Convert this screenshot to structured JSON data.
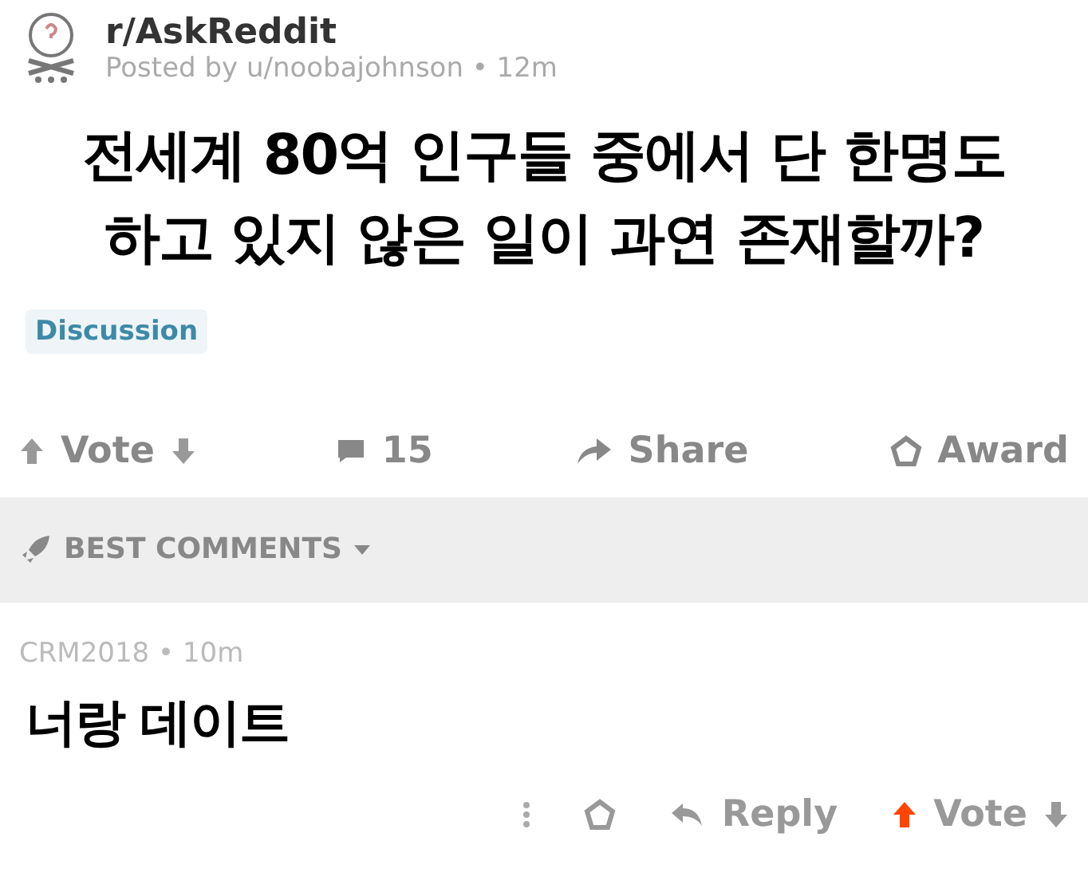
{
  "post": {
    "subreddit": "r/AskReddit",
    "byline": "Posted by u/noobajohnson • 12m",
    "title_lines": [
      "전세계 80억 인구들 중에서 단 한명도",
      "하고 있지 않은 일이 과연 존재할까?"
    ],
    "flair": "Discussion",
    "actions": {
      "vote_label": "Vote",
      "upvoted": false,
      "comments": "15",
      "share": "Share",
      "award": "Award"
    }
  },
  "sort": {
    "label": "BEST COMMENTS"
  },
  "comments": [
    {
      "meta": "CRM2018 • 10m",
      "text": "너랑 데이트",
      "reply": "Reply",
      "vote_label": "Vote",
      "upvoted": true
    }
  ]
}
